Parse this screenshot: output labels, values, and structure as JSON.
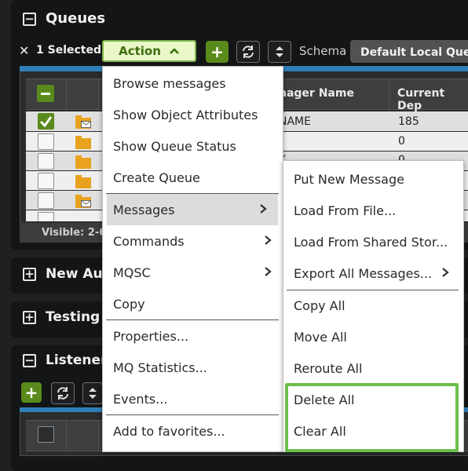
{
  "queues": {
    "title": "Queues",
    "selected_text": "1 Selected",
    "action_label": "Action",
    "schema_label": "Schema",
    "schema_value": "Default Local Que...",
    "columns": {
      "manager_name": "nager Name",
      "current_depth": "Current Dep"
    },
    "rows": [
      {
        "manager": "NAME",
        "depth": "185",
        "checked": true
      },
      {
        "manager": "",
        "depth": "0",
        "checked": false
      },
      {
        "manager": "K",
        "depth": "0",
        "checked": false
      },
      {
        "manager": "",
        "depth": "",
        "checked": false
      },
      {
        "manager": "",
        "depth": "",
        "checked": false
      }
    ],
    "visible_text": "Visible: 2-6"
  },
  "sections": {
    "new_auth": "New Au",
    "testing": "Testing",
    "listeners": "Listener"
  },
  "action_menu": {
    "items": [
      {
        "label": "Browse messages"
      },
      {
        "label": "Show Object Attributes"
      },
      {
        "label": "Show Queue Status"
      },
      {
        "label": "Create Queue"
      },
      {
        "label": "Messages"
      },
      {
        "label": "Commands"
      },
      {
        "label": "MQSC"
      },
      {
        "label": "Copy"
      },
      {
        "label": "Properties..."
      },
      {
        "label": "MQ Statistics..."
      },
      {
        "label": "Events..."
      },
      {
        "label": "Add to favorites..."
      }
    ]
  },
  "messages_submenu": {
    "items": [
      {
        "label": "Put New Message"
      },
      {
        "label": "Load From File..."
      },
      {
        "label": "Load From Shared Stor..."
      },
      {
        "label": "Export All Messages..."
      },
      {
        "label": "Copy All"
      },
      {
        "label": "Move All"
      },
      {
        "label": "Reroute All"
      },
      {
        "label": "Delete All"
      },
      {
        "label": "Clear All"
      }
    ]
  },
  "colors": {
    "accent_green": "#5a8a1c",
    "highlight_border": "#6cbf4a",
    "menu_hover": "#dcdcdc"
  },
  "icons": [
    "close-icon",
    "chevron-up-icon",
    "plus-icon",
    "refresh-icon",
    "sort-icon",
    "folder-icon",
    "chevron-right-icon",
    "expand-icon",
    "collapse-icon"
  ]
}
